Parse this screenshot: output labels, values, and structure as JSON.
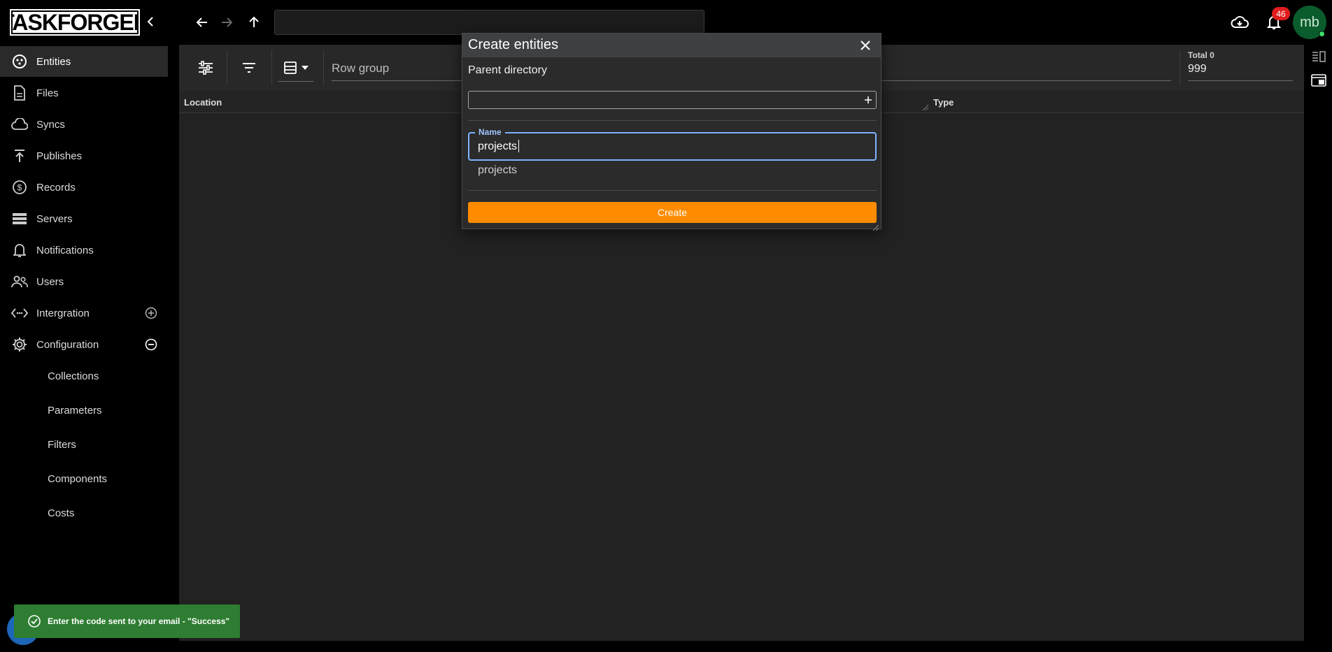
{
  "app": {
    "logo_text": "TASKFORGER"
  },
  "topbar": {
    "path_value": "",
    "notification_count": "46",
    "avatar_initials": "mb"
  },
  "sidebar": {
    "items": [
      {
        "label": "Entities",
        "icon": "entities-icon",
        "active": true
      },
      {
        "label": "Files",
        "icon": "file-icon"
      },
      {
        "label": "Syncs",
        "icon": "cloud-sync-icon"
      },
      {
        "label": "Publishes",
        "icon": "publish-icon"
      },
      {
        "label": "Records",
        "icon": "dollar-circle-icon"
      },
      {
        "label": "Servers",
        "icon": "server-icon"
      },
      {
        "label": "Notifications",
        "icon": "bell-icon"
      },
      {
        "label": "Users",
        "icon": "users-icon"
      },
      {
        "label": "Intergration",
        "icon": "code-icon",
        "trailing": "expand-plus-icon"
      },
      {
        "label": "Configuration",
        "icon": "gear-icon",
        "trailing": "collapse-minus-icon"
      }
    ],
    "config_children": [
      "Collections",
      "Parameters",
      "Filters",
      "Components",
      "Costs"
    ]
  },
  "toolbar": {
    "row_group_placeholder": "Row group",
    "total_label": "Total 0",
    "total_value": "999"
  },
  "table": {
    "columns": [
      "Location",
      "Type"
    ]
  },
  "dialog": {
    "title": "Create entities",
    "parent_label": "Parent directory",
    "parent_value": "",
    "name_label": "Name",
    "name_value": "projects",
    "suggestion": "projects",
    "create_label": "Create"
  },
  "toast": {
    "message": "Enter the code sent to your email - \"Success\"",
    "color": "#2e7d32"
  },
  "colors": {
    "accent": "#ff8c00",
    "focus": "#7fb3ff",
    "badge": "#e11d1d"
  }
}
